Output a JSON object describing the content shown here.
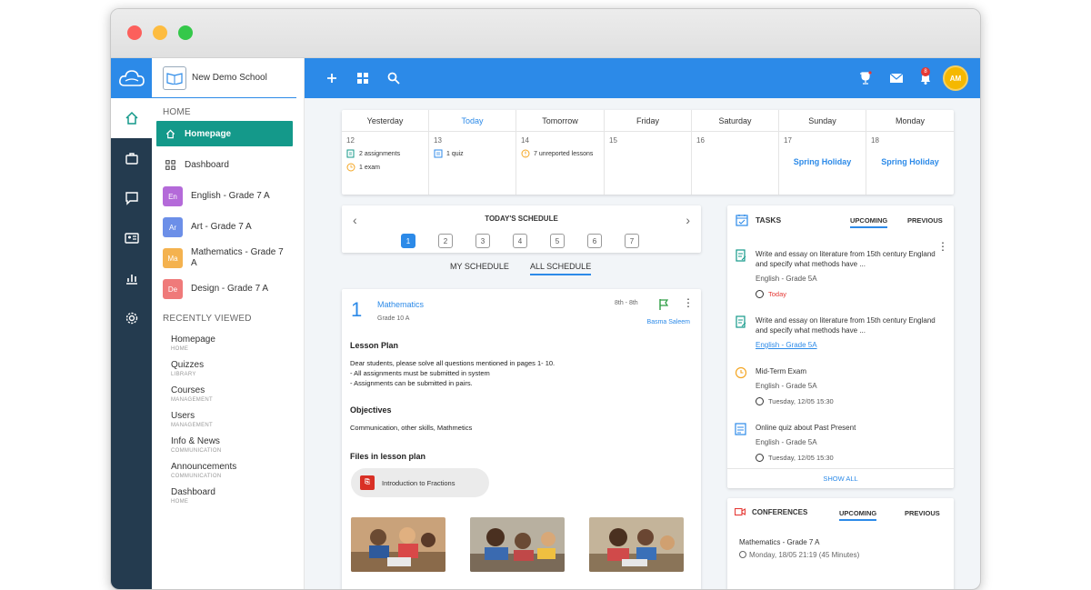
{
  "school": {
    "name": "New Demo School"
  },
  "sidebar": {
    "home_label": "HOME",
    "nav": [
      {
        "label": "Homepage",
        "icon": "home-icon"
      },
      {
        "label": "Dashboard",
        "icon": "grid-icon"
      }
    ],
    "courses": [
      {
        "abbr": "En",
        "name": "English - Grade 7 A",
        "color": "#b46ad9"
      },
      {
        "abbr": "Ar",
        "name": "Art - Grade 7 A",
        "color": "#6c8fe8"
      },
      {
        "abbr": "Ma",
        "name": "Mathematics - Grade 7 A",
        "color": "#f4b24f"
      },
      {
        "abbr": "De",
        "name": "Design - Grade 7 A",
        "color": "#ef7a7a"
      }
    ],
    "recent_label": "RECENTLY VIEWED",
    "recent": [
      {
        "title": "Homepage",
        "sub": "HOME"
      },
      {
        "title": "Quizzes",
        "sub": "LIBRARY"
      },
      {
        "title": "Courses",
        "sub": "MANAGEMENT"
      },
      {
        "title": "Users",
        "sub": "MANAGEMENT"
      },
      {
        "title": "Info & News",
        "sub": "COMMUNICATION"
      },
      {
        "title": "Announcements",
        "sub": "COMMUNICATION"
      },
      {
        "title": "Dashboard",
        "sub": "HOME"
      }
    ]
  },
  "topbar": {
    "avatar_initials": "AM",
    "notification_count": "8"
  },
  "week": {
    "days": [
      {
        "name": "Yesterday",
        "num": "12"
      },
      {
        "name": "Today",
        "num": "13"
      },
      {
        "name": "Tomorrow",
        "num": "14"
      },
      {
        "name": "Friday",
        "num": "15"
      },
      {
        "name": "Saturday",
        "num": "16"
      },
      {
        "name": "Sunday",
        "num": "17"
      },
      {
        "name": "Monday",
        "num": "18"
      }
    ],
    "events": {
      "assignments": "2 assignments",
      "exam": "1 exam",
      "quiz": "1 quiz",
      "unreported": "7 unreported lessons"
    },
    "holiday": "Spring Holiday"
  },
  "schedule": {
    "title": "TODAY'S SCHEDULE",
    "periods": [
      "1",
      "2",
      "3",
      "4",
      "5",
      "6",
      "7"
    ],
    "tab_my": "MY SCHEDULE",
    "tab_all": "ALL SCHEDULE"
  },
  "lesson": {
    "number": "1",
    "subject": "Mathematics",
    "grade": "Grade 10 A",
    "time": "8th - 8th",
    "teacher": "Basma Saleem",
    "plan_heading": "Lesson Plan",
    "plan_line1": "Dear students, please solve all questions mentioned in pages 1- 10.",
    "plan_line2": "- All assignments must be submitted in system",
    "plan_line3": "- Assignments can be submitted in pairs.",
    "objectives_heading": "Objectives",
    "objectives_text": "Communication, other skills, Mathmetics",
    "files_heading": "Files in lesson plan",
    "file_name": "Introduction to Fractions"
  },
  "tasks": {
    "title": "TASKS",
    "tab_upcoming": "UPCOMING",
    "tab_previous": "PREVIOUS",
    "items": [
      {
        "title": "Write and essay on literature from 15th century England and specify what methods have ...",
        "course": "English - Grade 5A",
        "date": "Today"
      },
      {
        "title": "Write and essay on literature from 15th century England and specify what methods have ...",
        "course": "English - Grade 5A",
        "date": ""
      },
      {
        "title": "Mid-Term Exam",
        "course": "English - Grade 5A",
        "date": "Tuesday, 12/05 15:30"
      },
      {
        "title": "Online quiz about Past Present",
        "course": "English - Grade 5A",
        "date": "Tuesday, 12/05 15:30"
      }
    ],
    "show_all": "SHOW ALL"
  },
  "conferences": {
    "title": "CONFERENCES",
    "tab_upcoming": "UPCOMING",
    "tab_previous": "PREVIOUS",
    "item_title": "Mathematics - Grade 7 A",
    "item_date": "Monday, 18/05 21:19 (45 Minutes)"
  },
  "colors": {
    "primary": "#2c8ae8",
    "rail": "#243b4f",
    "active_nav": "#14998a",
    "danger": "#e53935"
  }
}
